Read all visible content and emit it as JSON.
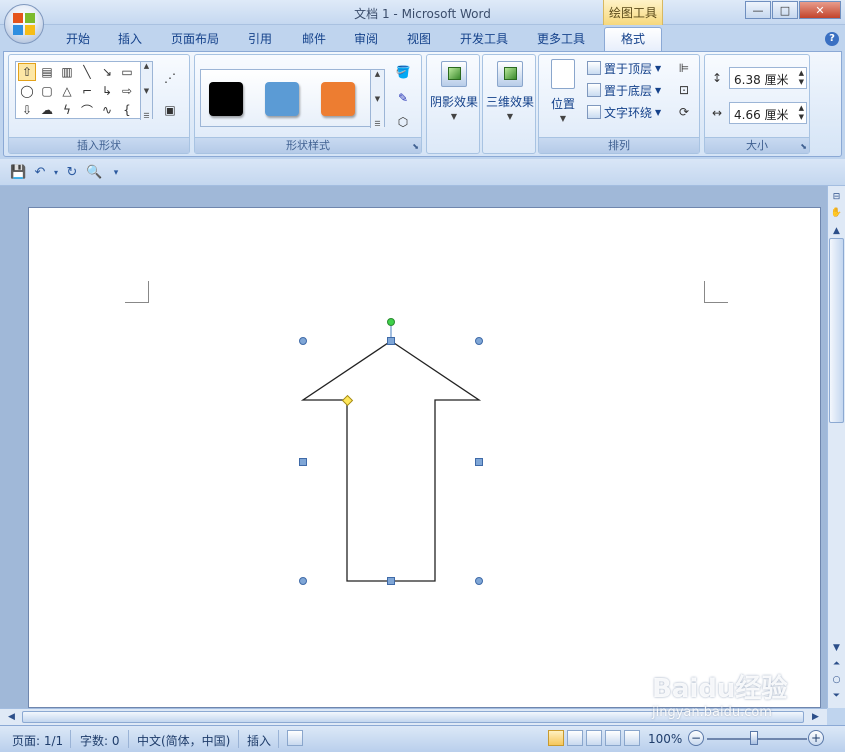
{
  "window": {
    "title": "文档 1 - Microsoft Word",
    "context_tab_title": "绘图工具",
    "buttons": {
      "minimize": "—",
      "maximize": "□",
      "close": "✕"
    }
  },
  "tabs": [
    {
      "label": "开始",
      "active": false
    },
    {
      "label": "插入",
      "active": false
    },
    {
      "label": "页面布局",
      "active": false
    },
    {
      "label": "引用",
      "active": false
    },
    {
      "label": "邮件",
      "active": false
    },
    {
      "label": "审阅",
      "active": false
    },
    {
      "label": "视图",
      "active": false
    },
    {
      "label": "开发工具",
      "active": false
    },
    {
      "label": "更多工具",
      "active": false
    },
    {
      "label": "格式",
      "active": true
    }
  ],
  "help": "?",
  "ribbon": {
    "insert_shapes": {
      "label": "插入形状"
    },
    "shape_styles": {
      "label": "形状样式",
      "swatches": [
        "#000000",
        "#5b9bd5",
        "#ed7d31"
      ]
    },
    "shadow_effects": {
      "label": "阴影效果"
    },
    "threed_effects": {
      "label": "三维效果"
    },
    "arrange": {
      "label": "排列",
      "position": "位置",
      "bring_to_front": "置于顶层",
      "send_to_back": "置于底层",
      "text_wrap": "文字环绕"
    },
    "size": {
      "label": "大小",
      "height": "6.38 厘米",
      "width": "4.66 厘米"
    }
  },
  "status": {
    "page": "页面: 1/1",
    "words": "字数: 0",
    "language": "中文(简体，中国)",
    "mode": "插入",
    "zoom": "100%",
    "zoom_minus": "−",
    "zoom_plus": "+"
  },
  "watermark": {
    "main": "Baidu经验",
    "sub": "jingyan.baidu.com"
  }
}
